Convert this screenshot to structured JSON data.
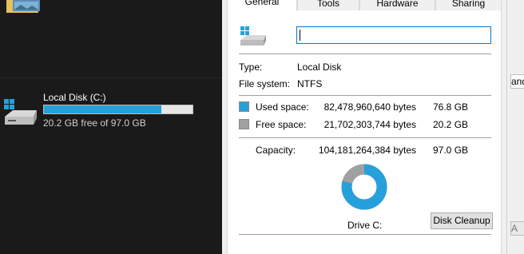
{
  "explorer": {
    "drive_label": "Local Disk (C:)",
    "free_text": "20.2 GB free of 97.0 GB",
    "usage_fraction": 0.79
  },
  "dialog": {
    "tabs": [
      "General",
      "Tools",
      "Hardware",
      "Sharing"
    ],
    "active_tab": "General",
    "name_value": "",
    "type_label": "Type:",
    "type_value": "Local Disk",
    "fs_label": "File system:",
    "fs_value": "NTFS",
    "used": {
      "label": "Used space:",
      "bytes": "82,478,960,640 bytes",
      "size": "76.8 GB",
      "color": "#26a0da"
    },
    "free": {
      "label": "Free space:",
      "bytes": "21,702,303,744 bytes",
      "size": "20.2 GB",
      "color": "#a0a0a0"
    },
    "capacity": {
      "label": "Capacity:",
      "bytes": "104,181,264,384 bytes",
      "size": "97.0 GB"
    },
    "drive_caption": "Drive C:",
    "cleanup_button": "Disk Cleanup",
    "used_fraction": 0.792
  },
  "right_strip": {
    "field_text": "and",
    "field2_text": "A"
  }
}
